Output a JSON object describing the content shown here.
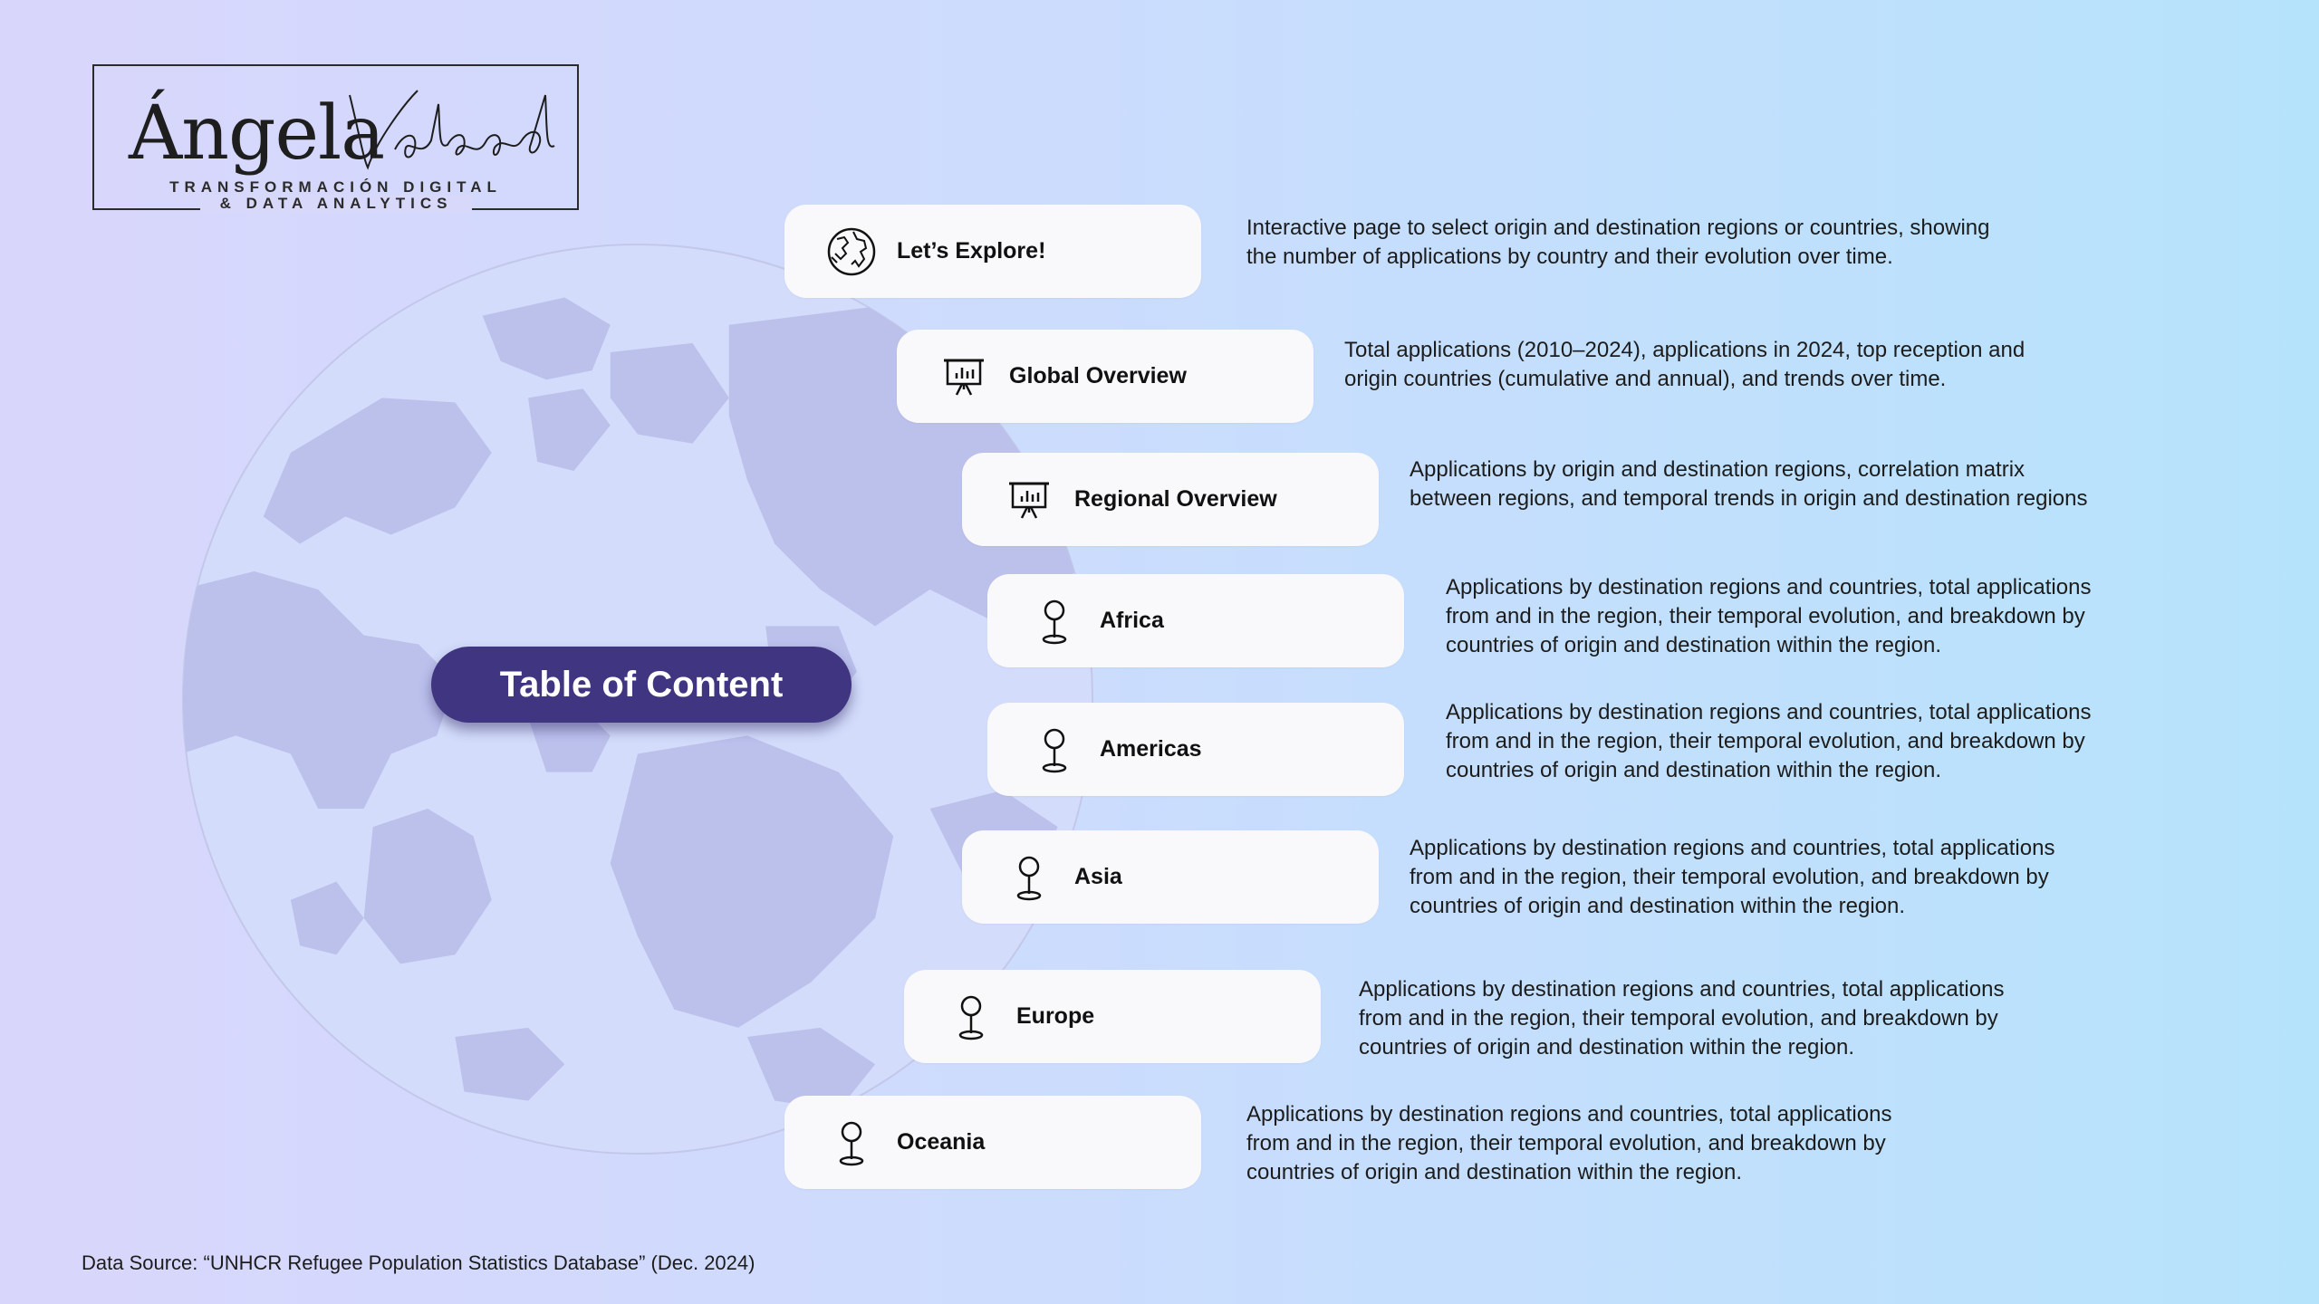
{
  "logo": {
    "name": "Ángela",
    "script": "Valcárcel",
    "subtitle_line1": "TRANSFORMACIÓN DIGITAL",
    "subtitle_line2": "& DATA ANALYTICS"
  },
  "title": "Table of Content",
  "items": [
    {
      "label": "Let’s Explore!",
      "icon": "globe-icon",
      "desc": "Interactive page to select origin and destination regions or countries, showing\nthe number of applications by country and their evolution over time."
    },
    {
      "label": "Global Overview",
      "icon": "presentation-chart-icon",
      "desc": "Total applications (2010–2024), applications in 2024, top reception and\norigin countries (cumulative and annual), and trends over time."
    },
    {
      "label": "Regional Overview",
      "icon": "presentation-chart-icon",
      "desc": "Applications by origin and destination regions, correlation matrix\nbetween regions, and temporal trends in origin and destination regions"
    },
    {
      "label": "Africa",
      "icon": "map-pin-icon",
      "desc": "Applications by destination regions and countries, total applications\nfrom and in the region, their temporal evolution, and breakdown by\ncountries of origin and destination within the region."
    },
    {
      "label": "Americas",
      "icon": "map-pin-icon",
      "desc": "Applications by destination regions and countries, total applications\nfrom and in the region, their temporal evolution, and breakdown by\ncountries of origin and destination within the region."
    },
    {
      "label": "Asia",
      "icon": "map-pin-icon",
      "desc": "Applications by destination regions and countries, total applications\nfrom and in the region, their temporal evolution, and breakdown by\ncountries of origin and destination within the region."
    },
    {
      "label": "Europe",
      "icon": "map-pin-icon",
      "desc": "Applications by destination regions and countries, total applications\nfrom and in the region, their temporal evolution, and breakdown by\ncountries of origin and destination within the region."
    },
    {
      "label": "Oceania",
      "icon": "map-pin-icon",
      "desc": "Applications by destination regions and countries, total applications\nfrom and in the region, their temporal evolution, and breakdown by\ncountries of origin and destination within the region."
    }
  ],
  "source": "Data Source:  “UNHCR Refugee Population Statistics Database” (Dec. 2024)",
  "colors": {
    "accent": "#3f3580",
    "card": "#f9f9fb",
    "globe": "#b9bfe8"
  }
}
